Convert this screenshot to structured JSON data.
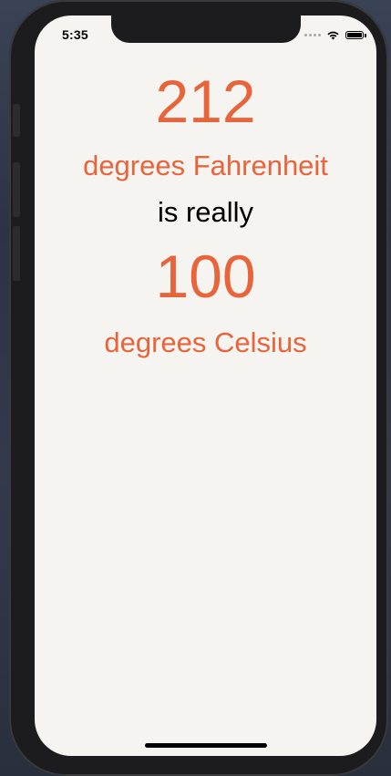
{
  "status_bar": {
    "time": "5:35",
    "icons": [
      "cellular-signal-icon",
      "wifi-icon",
      "battery-icon"
    ]
  },
  "converter": {
    "fahrenheit_value": "212",
    "fahrenheit_unit": "degrees Fahrenheit",
    "connector": "is really",
    "celsius_value": "100",
    "celsius_unit": "degrees Celsius"
  },
  "colors": {
    "accent": "#e8643a",
    "background": "#f5f4f1",
    "text": "#000000"
  }
}
